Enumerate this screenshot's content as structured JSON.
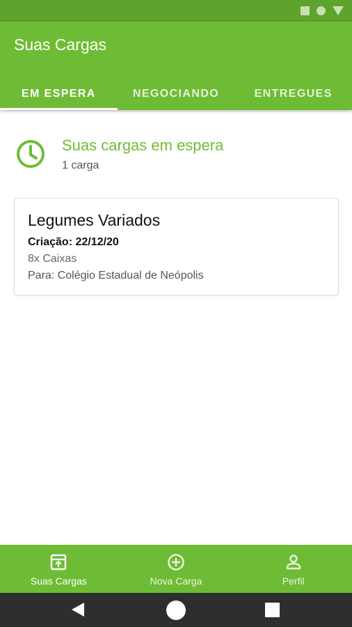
{
  "colors": {
    "primary": "#6ebc35",
    "status_bar": "#5ea32b",
    "system_nav": "#2e2e2e",
    "accent_text": "#6ebc35"
  },
  "app_bar": {
    "title": "Suas Cargas"
  },
  "tabs": [
    {
      "label": "EM ESPERA",
      "active": true
    },
    {
      "label": "NEGOCIANDO",
      "active": false
    },
    {
      "label": "ENTREGUES",
      "active": false
    }
  ],
  "section": {
    "icon": "clock-icon",
    "title": "Suas cargas em espera",
    "count": "1 carga"
  },
  "cards": [
    {
      "title": "Legumes Variados",
      "date": "Criação: 22/12/20",
      "quantity": "8x Caixas",
      "destination": "Para: Colégio Estadual de Neópolis"
    }
  ],
  "bottom_nav": [
    {
      "label": "Suas Cargas",
      "icon": "archive-box-icon",
      "active": true
    },
    {
      "label": "Nova Carga",
      "icon": "add-circle-icon",
      "active": false
    },
    {
      "label": "Perfil",
      "icon": "person-icon",
      "active": false
    }
  ]
}
